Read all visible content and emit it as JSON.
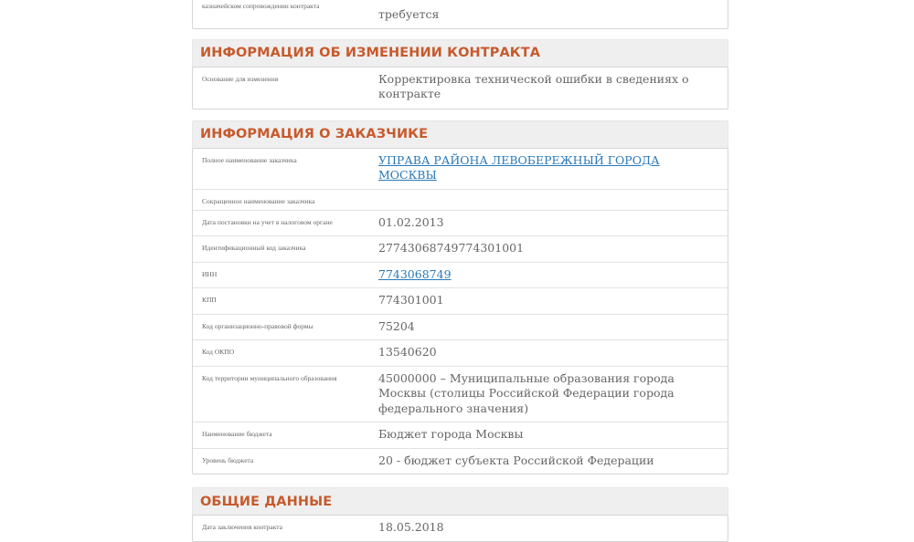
{
  "top_table": {
    "label": "казначейском сопровождении контракта",
    "value_line1": "",
    "value_line2": "требуется"
  },
  "change_section": {
    "title": "ИНФОРМАЦИЯ ОБ ИЗМЕНЕНИИ КОНТРАКТА",
    "rows": [
      {
        "label": "Основание для изменения",
        "value": "Корректировка технической ошибки в сведениях о контракте"
      }
    ]
  },
  "customer_section": {
    "title": "ИНФОРМАЦИЯ О ЗАКАЗЧИКЕ",
    "rows": [
      {
        "label": "Полное наименование заказчика",
        "value": "УПРАВА РАЙОНА ЛЕВОБЕРЕЖНЫЙ ГОРОДА МОСКВЫ"
      },
      {
        "label": "Сокращенное наименование заказчика",
        "value": ""
      },
      {
        "label": "Дата постановки на учет в налоговом органе",
        "value": "01.02.2013"
      },
      {
        "label": "Идентификационный код заказчика",
        "value": "27743068749774301001"
      },
      {
        "label": "ИНН",
        "value": "7743068749"
      },
      {
        "label": "КПП",
        "value": "774301001"
      },
      {
        "label": "Код организационно-правовой формы",
        "value": "75204"
      },
      {
        "label": "Код ОКПО",
        "value": "13540620"
      },
      {
        "label": "Код территории муниципального образования",
        "value": "45000000 – Муниципальные образования города Москвы (столицы Российской Федерации города федерального значения)"
      },
      {
        "label": "Наименование бюджета",
        "value": "Бюджет города Москвы"
      },
      {
        "label": "Уровень бюджета",
        "value": "20 - бюджет субъекта Российской Федерации"
      }
    ]
  },
  "general_section": {
    "title": "ОБЩИЕ ДАННЫЕ",
    "rows": [
      {
        "label": "Дата заключения контракта",
        "value": "18.05.2018"
      }
    ]
  }
}
